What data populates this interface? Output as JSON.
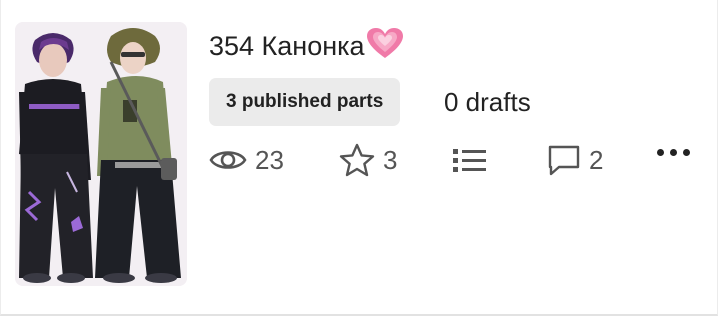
{
  "story": {
    "title": "354 Канонка",
    "title_emoji": "heart-emoji",
    "published_parts": "3 published parts",
    "drafts": "0 drafts"
  },
  "stats": {
    "views": "23",
    "votes": "3",
    "comments": "2"
  },
  "icons": {
    "views": "eye-icon",
    "votes": "star-icon",
    "parts": "list-icon",
    "comments": "comment-icon",
    "more": "more-icon"
  },
  "colors": {
    "badge_bg": "#ebebeb",
    "heart": "#f07aa8",
    "icon": "#555555"
  }
}
